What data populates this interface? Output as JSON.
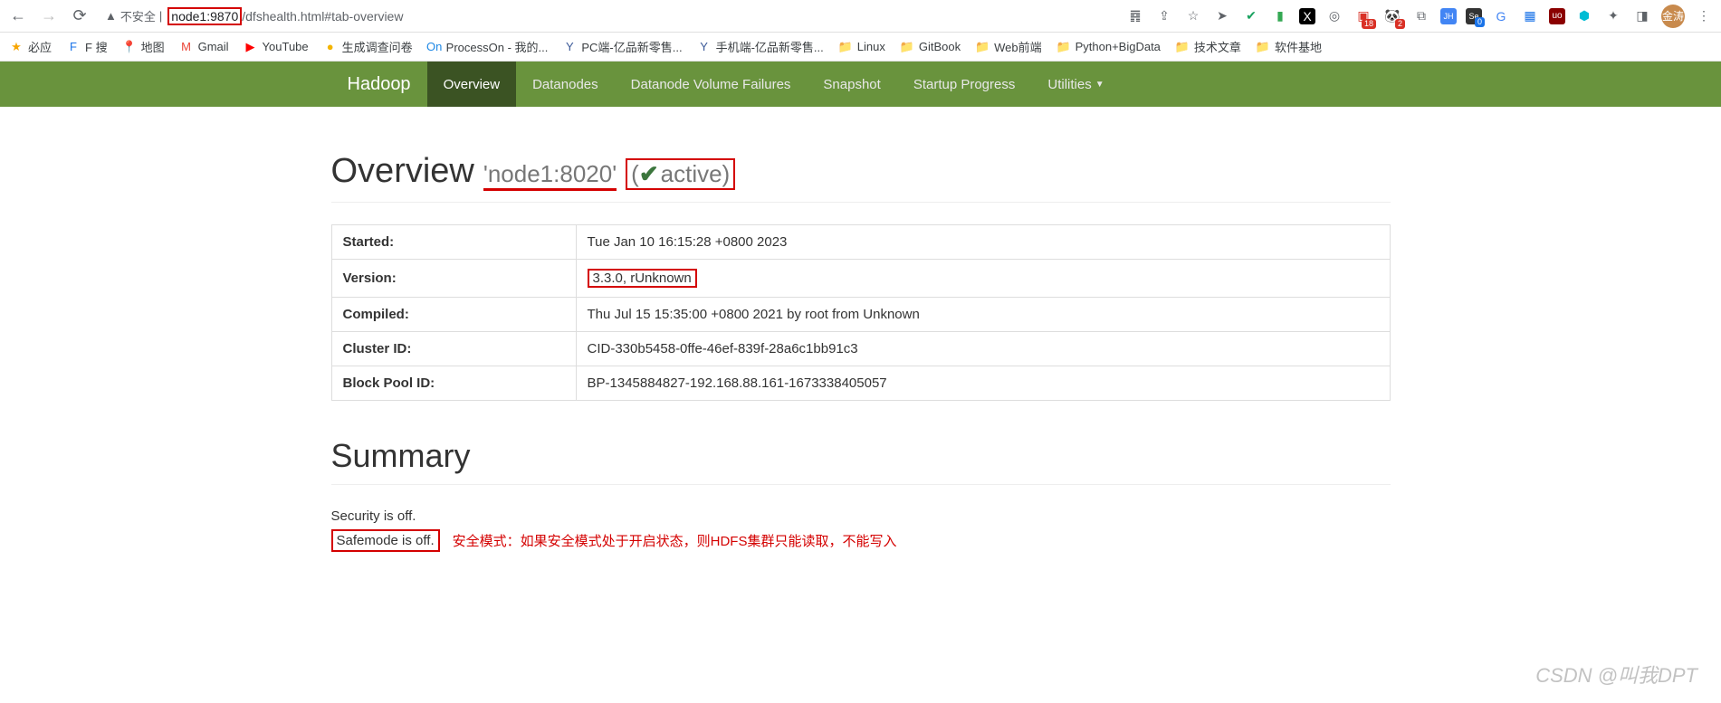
{
  "browser": {
    "security_label": "不安全",
    "url_host": "node1:9870",
    "url_path": "/dfshealth.html#tab-overview",
    "avatar_text": "金涛"
  },
  "bookmarks": [
    {
      "icon": "★",
      "label": "必应",
      "color": "#f7a500"
    },
    {
      "icon": "F",
      "label": "F 搜",
      "color": "#1a73e8"
    },
    {
      "icon": "📍",
      "label": "地图",
      "color": ""
    },
    {
      "icon": "M",
      "label": "Gmail",
      "color": "#ea4335"
    },
    {
      "icon": "▶",
      "label": "YouTube",
      "color": "#ff0000"
    },
    {
      "icon": "●",
      "label": "生成调查问卷",
      "color": "#f4b400"
    },
    {
      "icon": "On",
      "label": "ProcessOn - 我的...",
      "color": "#1e88e5"
    },
    {
      "icon": "Y",
      "label": "PC端-亿品新零售...",
      "color": "#3b5998"
    },
    {
      "icon": "Y",
      "label": "手机端-亿品新零售...",
      "color": "#3b5998"
    },
    {
      "icon": "📁",
      "label": "Linux",
      "color": "#f4b400"
    },
    {
      "icon": "📁",
      "label": "GitBook",
      "color": "#f4b400"
    },
    {
      "icon": "📁",
      "label": "Web前端",
      "color": "#f4b400"
    },
    {
      "icon": "📁",
      "label": "Python+BigData",
      "color": "#f4b400"
    },
    {
      "icon": "📁",
      "label": "技术文章",
      "color": "#f4b400"
    },
    {
      "icon": "📁",
      "label": "软件基地",
      "color": "#f4b400"
    }
  ],
  "ext_icons": {
    "badge18": "18",
    "badge2": "2",
    "badge0": "0"
  },
  "nav": {
    "brand": "Hadoop",
    "items": [
      "Overview",
      "Datanodes",
      "Datanode Volume Failures",
      "Snapshot",
      "Startup Progress",
      "Utilities"
    ]
  },
  "overview": {
    "title": "Overview",
    "host": "'node1:8020'",
    "status_prefix": "(",
    "status_text": "active)",
    "rows": [
      {
        "label": "Started:",
        "value": "Tue Jan 10 16:15:28 +0800 2023"
      },
      {
        "label": "Version:",
        "value": "3.3.0, rUnknown"
      },
      {
        "label": "Compiled:",
        "value": "Thu Jul 15 15:35:00 +0800 2021 by root from Unknown"
      },
      {
        "label": "Cluster ID:",
        "value": "CID-330b5458-0ffe-46ef-839f-28a6c1bb91c3"
      },
      {
        "label": "Block Pool ID:",
        "value": "BP-1345884827-192.168.88.161-1673338405057"
      }
    ]
  },
  "summary": {
    "title": "Summary",
    "security_line": "Security is off.",
    "safemode_line": "Safemode is off.",
    "annotation": "安全模式：如果安全模式处于开启状态，则HDFS集群只能读取，不能写入"
  },
  "watermark": "CSDN @叫我DPT"
}
